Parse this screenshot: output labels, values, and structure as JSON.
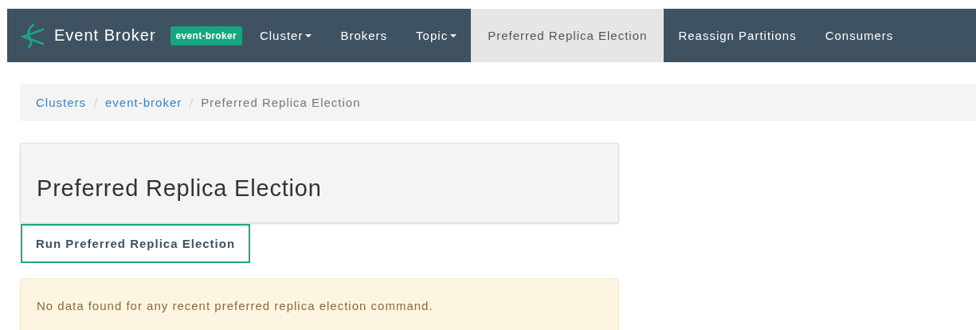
{
  "navbar": {
    "brand": "Event Broker",
    "cluster_badge": "event-broker",
    "items": [
      {
        "label": "Cluster",
        "dropdown": true,
        "selected": false
      },
      {
        "label": "Brokers",
        "dropdown": false,
        "selected": false
      },
      {
        "label": "Topic",
        "dropdown": true,
        "selected": false
      },
      {
        "label": "Preferred Replica Election",
        "dropdown": false,
        "selected": true
      },
      {
        "label": "Reassign Partitions",
        "dropdown": false,
        "selected": false
      },
      {
        "label": "Consumers",
        "dropdown": false,
        "selected": false
      }
    ]
  },
  "breadcrumb": [
    {
      "label": "Clusters",
      "link": true
    },
    {
      "label": "event-broker",
      "link": true
    },
    {
      "label": "Preferred Replica Election",
      "link": false
    }
  ],
  "page_heading": "Preferred Replica Election",
  "run_button": "Run Preferred Replica Election",
  "alert": "No data found for any recent preferred replica election command."
}
